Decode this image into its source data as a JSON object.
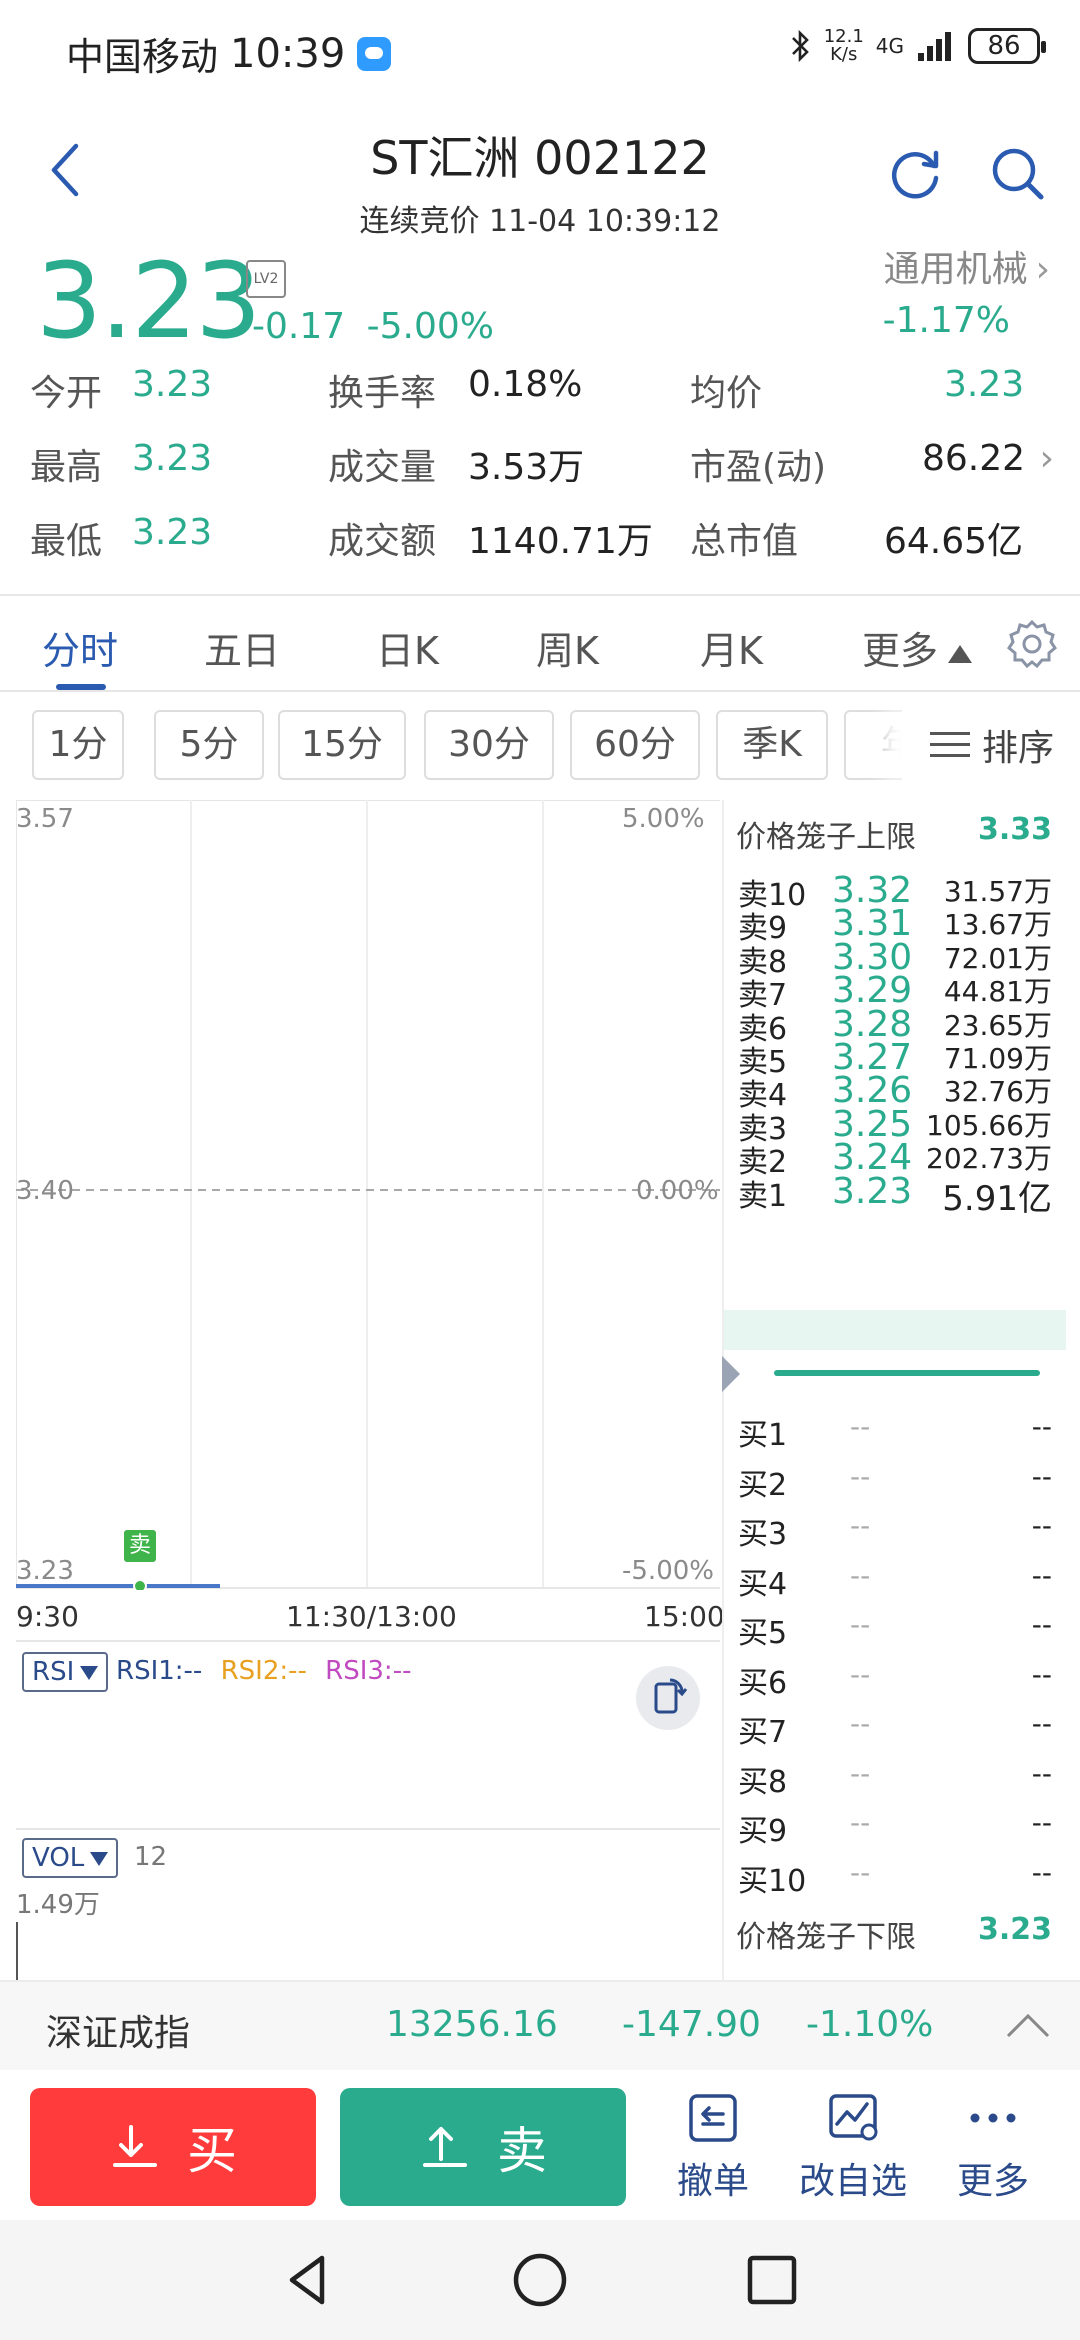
{
  "status": {
    "carrier": "中国移动",
    "time": "10:39",
    "speed_top": "12.1",
    "speed_unit": "K/s",
    "network": "4G",
    "battery": "86"
  },
  "header": {
    "title": "ST汇洲 002122",
    "subtitle": "连续竞价 11-04 10:39:12"
  },
  "quote": {
    "price": "3.23",
    "lv_badge": "LV2",
    "change": "-0.17",
    "change_pct": "-5.00%",
    "sector_name": "通用机械",
    "sector_change": "-1.17%"
  },
  "stats": [
    [
      {
        "label": "今开",
        "value": "3.23"
      },
      {
        "label": "换手率",
        "value": "0.18%"
      },
      {
        "label": "均价",
        "value": "3.23"
      }
    ],
    [
      {
        "label": "最高",
        "value": "3.23"
      },
      {
        "label": "成交量",
        "value": "3.53万"
      },
      {
        "label": "市盈(动)",
        "value": "86.22"
      }
    ],
    [
      {
        "label": "最低",
        "value": "3.23"
      },
      {
        "label": "成交额",
        "value": "1140.71万"
      },
      {
        "label": "总市值",
        "value": "64.65亿"
      }
    ]
  ],
  "tabs": [
    "分时",
    "五日",
    "日K",
    "周K",
    "月K",
    "更多"
  ],
  "periods": [
    "1分",
    "5分",
    "15分",
    "30分",
    "60分",
    "季K",
    "年"
  ],
  "sort_label": "排序",
  "chart": {
    "y_top": "3.57",
    "y_mid": "3.40",
    "y_bot": "3.23",
    "pct_top": "5.00%",
    "pct_mid": "0.00%",
    "pct_bot": "-5.00%",
    "sell_marker": "卖",
    "time_start": "9:30",
    "time_mid": "11:30/13:00",
    "time_end": "15:00",
    "line_color": "#4a78c8",
    "price_fraction": 0
  },
  "rsi": {
    "chip": "RSI",
    "rsi1": "RSI1:--",
    "rsi2": "RSI2:--",
    "rsi3": "RSI3:--"
  },
  "vol": {
    "chip": "VOL",
    "value": "12",
    "max": "1.49万"
  },
  "orderbook": {
    "upper_label": "价格笼子上限",
    "upper_value": "3.33",
    "lower_label": "价格笼子下限",
    "lower_value": "3.23",
    "asks": [
      {
        "label": "卖10",
        "price": "3.32",
        "vol": "31.57万"
      },
      {
        "label": "卖9",
        "price": "3.31",
        "vol": "13.67万"
      },
      {
        "label": "卖8",
        "price": "3.30",
        "vol": "72.01万"
      },
      {
        "label": "卖7",
        "price": "3.29",
        "vol": "44.81万"
      },
      {
        "label": "卖6",
        "price": "3.28",
        "vol": "23.65万"
      },
      {
        "label": "卖5",
        "price": "3.27",
        "vol": "71.09万"
      },
      {
        "label": "卖4",
        "price": "3.26",
        "vol": "32.76万"
      },
      {
        "label": "卖3",
        "price": "3.25",
        "vol": "105.66万"
      },
      {
        "label": "卖2",
        "price": "3.24",
        "vol": "202.73万"
      },
      {
        "label": "卖1",
        "price": "3.23",
        "vol": "5.91亿"
      }
    ],
    "bids": [
      {
        "label": "买1",
        "price": "--",
        "vol": "--"
      },
      {
        "label": "买2",
        "price": "--",
        "vol": "--"
      },
      {
        "label": "买3",
        "price": "--",
        "vol": "--"
      },
      {
        "label": "买4",
        "price": "--",
        "vol": "--"
      },
      {
        "label": "买5",
        "price": "--",
        "vol": "--"
      },
      {
        "label": "买6",
        "price": "--",
        "vol": "--"
      },
      {
        "label": "买7",
        "price": "--",
        "vol": "--"
      },
      {
        "label": "买8",
        "price": "--",
        "vol": "--"
      },
      {
        "label": "买9",
        "price": "--",
        "vol": "--"
      },
      {
        "label": "买10",
        "price": "--",
        "vol": "--"
      }
    ]
  },
  "index": {
    "name": "深证成指",
    "value": "13256.16",
    "change": "-147.90",
    "pct": "-1.10%"
  },
  "actions": {
    "buy": "买",
    "sell": "卖",
    "cancel": "撤单",
    "watchlist": "改自选",
    "more": "更多"
  },
  "colors": {
    "down_green": "#2aab8e",
    "buy_red": "#ff3b3b",
    "brand_blue": "#2a5bb0"
  }
}
